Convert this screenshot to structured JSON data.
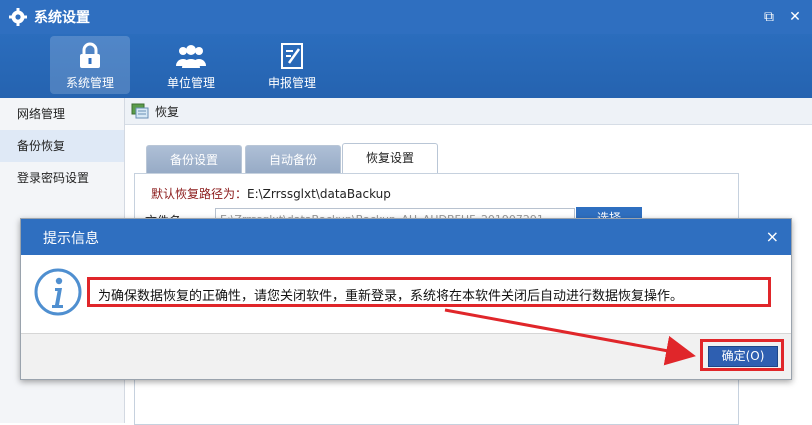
{
  "window": {
    "title": "系统设置",
    "restore_icon": "⧉",
    "close_icon": "✕"
  },
  "ribbon": {
    "items": [
      {
        "label": "系统管理",
        "icon": "lock-icon",
        "active": true
      },
      {
        "label": "单位管理",
        "icon": "users-icon",
        "active": false
      },
      {
        "label": "申报管理",
        "icon": "form-edit-icon",
        "active": false
      }
    ]
  },
  "sidebar": {
    "items": [
      {
        "label": "网络管理",
        "active": false
      },
      {
        "label": "备份恢复",
        "active": true
      },
      {
        "label": "登录密码设置",
        "active": false
      }
    ]
  },
  "breadcrumb": {
    "label": "恢复"
  },
  "tabs": [
    {
      "label": "备份设置",
      "active": false
    },
    {
      "label": "自动备份",
      "active": false
    },
    {
      "label": "恢复设置",
      "active": true
    }
  ],
  "restore": {
    "path_label": "默认恢复路径为：",
    "path_value": "E:\\Zrrssglxt\\dataBackup",
    "file_label": "文件名",
    "file_value": "E:\\Zrrssglxt\\dataBackup\\Backup_AH_AHDBFHF_201907291",
    "choose_label": "选择"
  },
  "dialog": {
    "title": "提示信息",
    "close_icon": "×",
    "message": "为确保数据恢复的正确性，请您关闭软件，重新登录，系统将在本软件关闭后自动进行数据恢复操作。",
    "ok_label": "确定(O)"
  },
  "colors": {
    "accent": "#2f6fc0",
    "highlight": "#e0262a",
    "path_label": "#8b1a1a"
  }
}
